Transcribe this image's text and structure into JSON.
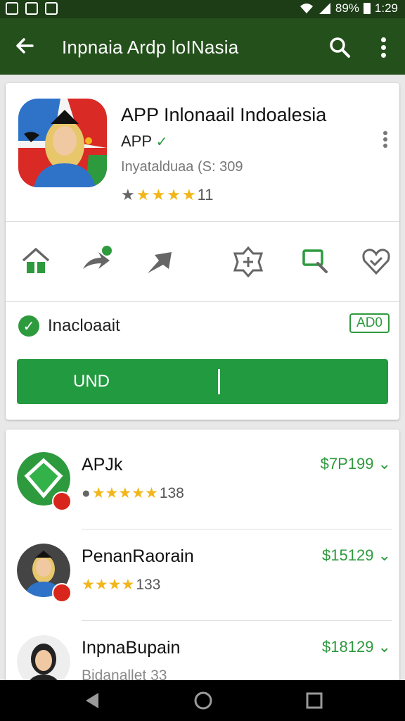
{
  "status_bar": {
    "battery": "89%",
    "time": "1:29"
  },
  "app_bar": {
    "title": "Inpnaia Ardp loINasia"
  },
  "app": {
    "title": "APP Inlonaail Indoalesia",
    "developer": "APP",
    "verified_mark": "✓",
    "info": "Inyatalduaa (S: 309",
    "rating_count": "11"
  },
  "installed": {
    "label": "Inacloaait",
    "badge": "AD0"
  },
  "primary_button": {
    "label": "UND"
  },
  "list": [
    {
      "name": "APJk",
      "rating_count": "138",
      "price": "$7P199 ⌄"
    },
    {
      "name": "PenanRaorain",
      "rating_count": "133",
      "price": "$15129 ⌄"
    },
    {
      "name": "InpnaBupain",
      "meta": "Bidanallet 33",
      "price": "$18129 ⌄"
    }
  ],
  "icons": {
    "back": "arrow-left-icon",
    "search": "search-icon",
    "more": "more-vert-icon",
    "actions": [
      "home-icon",
      "share-icon",
      "forward-icon",
      "badge-icon",
      "search-icon",
      "heart-icon"
    ]
  },
  "colors": {
    "app_bar": "#24501b",
    "status_bar": "#1d3d16",
    "accent": "#229a3f",
    "star": "#f2b61b"
  }
}
